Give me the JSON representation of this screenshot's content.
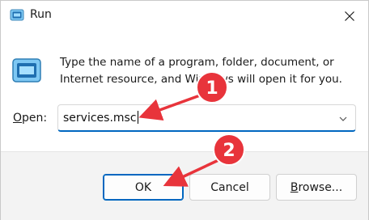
{
  "window": {
    "title": "Run",
    "icons": {
      "app": "run-app-icon",
      "close": "close-icon",
      "program": "run-program-icon",
      "dropdown": "chevron-down-icon"
    }
  },
  "body": {
    "description": "Type the name of a program, folder, document, or Internet resource, and Windows will open it for you."
  },
  "open": {
    "label_prefix": "",
    "label_accel": "O",
    "label_rest": "pen:",
    "value": "services.msc"
  },
  "buttons": {
    "ok": "OK",
    "cancel": "Cancel",
    "browse_accel": "B",
    "browse_rest": "rowse..."
  },
  "annotations": {
    "color": "#e8343b",
    "step1": "1",
    "step2": "2"
  }
}
